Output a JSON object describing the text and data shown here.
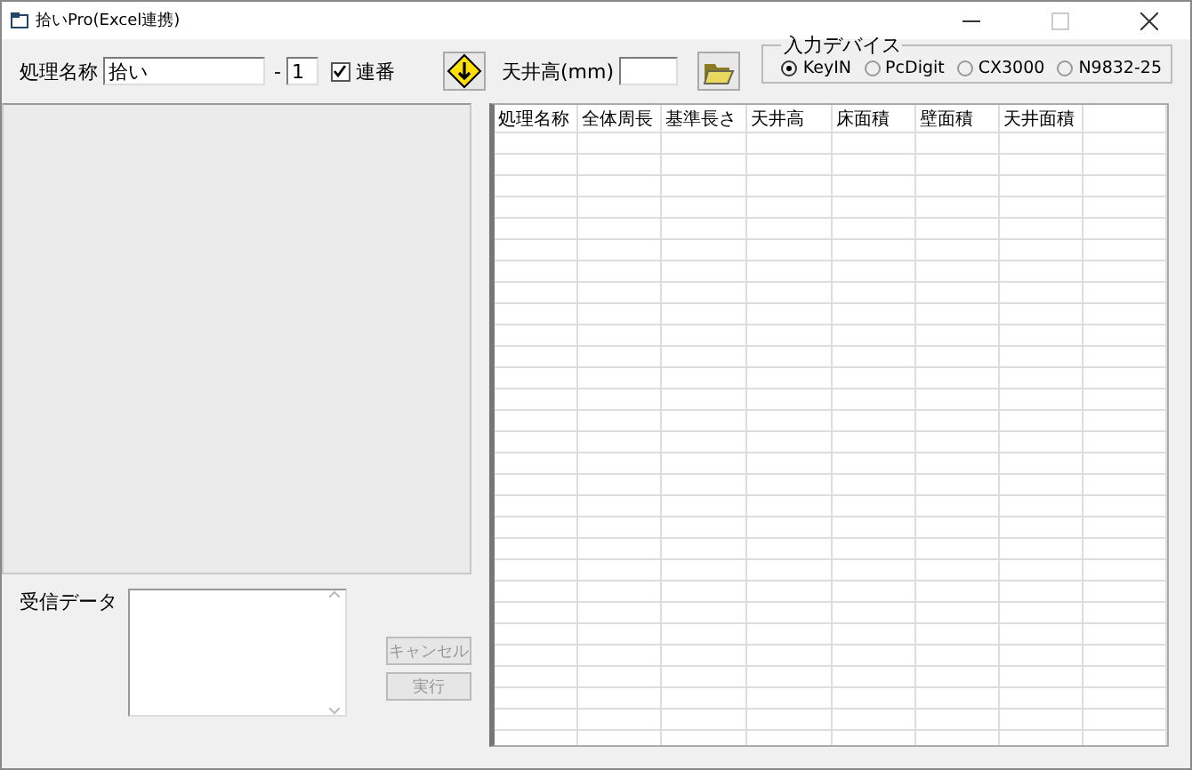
{
  "window": {
    "title": "拾いPro(Excel連携)"
  },
  "toolbar": {
    "name_label": "処理名称",
    "name_value": "拾い",
    "dash": "-",
    "number_value": "1",
    "serial": {
      "label": "連番",
      "checked": true
    },
    "ceiling_label": "天井高(mm)"
  },
  "input_device": {
    "title": "入力デバイス",
    "options": [
      {
        "label": "KeyIN",
        "selected": true
      },
      {
        "label": "PcDigit",
        "selected": false
      },
      {
        "label": "CX3000",
        "selected": false
      },
      {
        "label": "N9832-25",
        "selected": false
      }
    ]
  },
  "received": {
    "label": "受信データ"
  },
  "buttons": [
    {
      "label": "キャンセル",
      "disabled": true
    },
    {
      "label": "実行",
      "disabled": true
    }
  ],
  "table": {
    "columns": [
      "処理名称",
      "全体周長",
      "基準長さ",
      "天井高",
      "床面積",
      "壁面積",
      "天井面積"
    ]
  }
}
